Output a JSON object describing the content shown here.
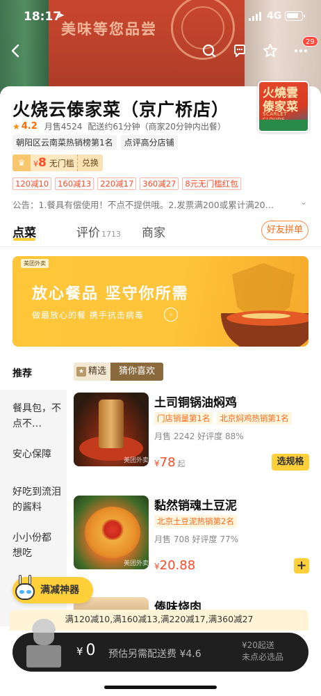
{
  "status_bar": {
    "time": "18:17",
    "network": "4G"
  },
  "header": {
    "banner_slogan": "美味等您品尝",
    "badge_count": "29"
  },
  "store": {
    "name": "火烧云傣家菜（京广桥店）",
    "rating": "4.2",
    "monthly_sales": "月售4524",
    "delivery": "配送约61分钟（商家20分钟内出餐）",
    "tags": [
      "朝阳区云南菜热销榜第1名",
      "点评高分店铺"
    ],
    "logo_text": "火燒雲 傣家菜",
    "logo_sub": "SCARLET CLOUDS RESTAURANT"
  },
  "vip": {
    "currency": "¥",
    "amount": "8",
    "label": "无门槛",
    "exchange": "兑换"
  },
  "discounts": [
    "120减10",
    "160减13",
    "220减17",
    "360减27",
    "8元无门槛红包"
  ],
  "notice": "公告：1.餐具有偿使用！不点不提供哦。2.发票满200或累计满20…",
  "tabs": {
    "order": "点菜",
    "reviews": "评价",
    "review_count": "1713",
    "merchant": "商家",
    "group_order": "好友拼单"
  },
  "promo": {
    "brand": "美团外卖",
    "title": "放心餐品 坚守你所需",
    "subtitle": "做最放心的餐 携手抗击病毒"
  },
  "sidebar": {
    "items": [
      "推荐",
      "餐具包，不点不…",
      "安心保障",
      "好吃到流泪的酱料",
      "小小份都想吃"
    ]
  },
  "section_tabs": {
    "featured": "精选",
    "guess": "猜你喜欢"
  },
  "dishes": [
    {
      "name": "土司铜锅油焖鸡",
      "labels": [
        "门店销量第1名",
        "北京焖鸡热销第1名"
      ],
      "stats": "月售 2242  好评度 88%",
      "currency": "¥",
      "price": "78",
      "suffix": "起",
      "action": "选规格"
    },
    {
      "name": "黏然销魂土豆泥",
      "labels": [
        "北京土豆泥热销第2名"
      ],
      "stats": "月售 708  好评度 77%",
      "currency": "¥",
      "price": "20.88",
      "action": "+"
    },
    {
      "name": "傣味烧肉"
    }
  ],
  "watermark": "美团外卖",
  "floating": {
    "manjian": "满减神器"
  },
  "tipbar": "满120减10,满160减13,满220减17,满360减27",
  "cart": {
    "currency": "¥",
    "total": "0",
    "fee": "预估另需配送费 ¥4.6",
    "min_order": "¥20起送",
    "required": "未点必选品"
  }
}
